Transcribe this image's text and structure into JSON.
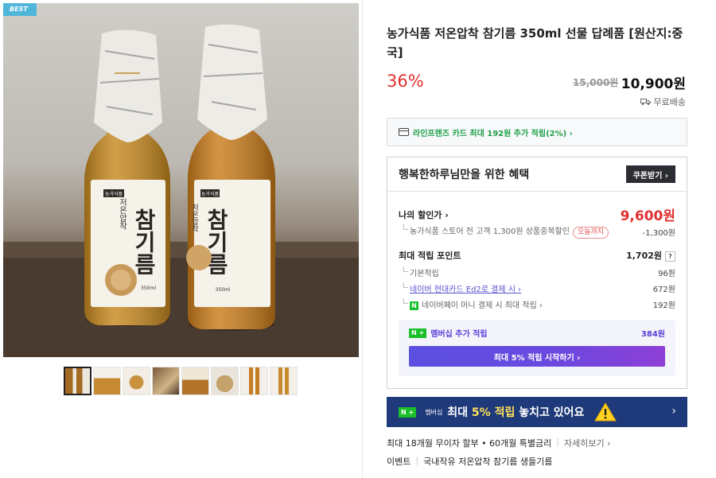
{
  "gallery": {
    "badge": "BEST",
    "bottle_left": {
      "brand": "농가식품",
      "title": "참기름",
      "subtitle": "저온압착",
      "volume": "350ml"
    },
    "bottle_right": {
      "brand": "농가식품",
      "title": "참기름",
      "subtitle": "저온압착",
      "volume": "350ml"
    },
    "thumbnails": 8,
    "active_thumbnail": 0
  },
  "product": {
    "title": "농가식품 저온압착 참기름 350ml 선물 답례품 [원산지:중국]",
    "discount_rate": "36%",
    "original_price": "15,000원",
    "sale_price": "10,900원",
    "shipping": "무료배송"
  },
  "card_promo": {
    "text": "라인프렌즈 카드 최대 192원 추가 적립(2%) ›"
  },
  "benefit": {
    "title": "행복한하루님만을 위한 혜택",
    "coupon_button": "쿠폰받기 ›",
    "my_price_label": "나의 할인가 ›",
    "my_price": "9,600원",
    "discount_detail_label": "농가식품 스토어 전 고객 1,300원 상품중복할인",
    "discount_detail_pill": "오늘까지",
    "discount_detail_value": "-1,300원",
    "points_label": "최대 적립 포인트",
    "points_value": "1,702원",
    "points_help": "?",
    "base_label": "기본적립",
    "base_value": "96원",
    "card_label": "네이버 현대카드 Ed2로 결제 시 ›",
    "card_value": "672원",
    "npay_label": "네이버페이 머니 결제 시 최대 적립 ›",
    "npay_value": "192원",
    "membership_label": "멤버십 추가 적립",
    "membership_value": "384원",
    "membership_button": "최대 5% 적립 시작하기 ›"
  },
  "banner": {
    "badge": "N +",
    "badge_sub": "멤버십",
    "text_prefix": "최대 ",
    "text_highlight": "5% 적립",
    "text_suffix": " 놓치고 있어요",
    "arrow": "›"
  },
  "footer": {
    "installment": "최대 18개월 무이자 할부 • 60개월 특별금리",
    "more": "자세히보기 ›",
    "event_label": "이벤트",
    "event_text": "국내작유 저온압착 참기름 생들기름"
  },
  "colors": {
    "accent_red": "#e03131",
    "naver_green": "#19c02a",
    "membership_purple": "#5a3fd8",
    "banner_navy": "#1f3a7a",
    "badge_blue": "#4fb6d9"
  }
}
